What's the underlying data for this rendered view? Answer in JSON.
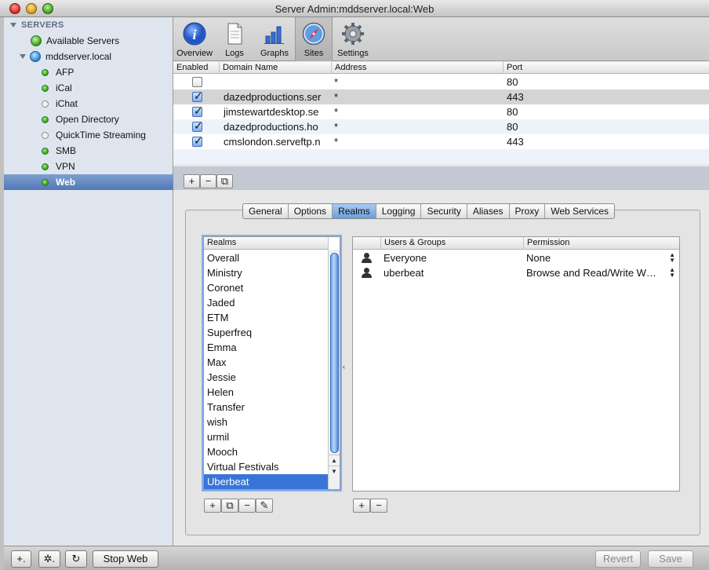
{
  "window": {
    "title": "Server Admin:mddserver.local:Web"
  },
  "sidebar": {
    "header": "SERVERS",
    "items": [
      {
        "label": "Available Servers",
        "icon": "available-servers-icon",
        "status": "globe-green"
      },
      {
        "label": "mddserver.local",
        "icon": "server-globe-icon",
        "status": "globe"
      },
      {
        "label": "AFP",
        "status": "running"
      },
      {
        "label": "iCal",
        "status": "running"
      },
      {
        "label": "iChat",
        "status": "stopped"
      },
      {
        "label": "Open Directory",
        "status": "running"
      },
      {
        "label": "QuickTime Streaming",
        "status": "stopped"
      },
      {
        "label": "SMB",
        "status": "running"
      },
      {
        "label": "VPN",
        "status": "running"
      },
      {
        "label": "Web",
        "status": "running",
        "selected": true
      }
    ]
  },
  "toolbar": {
    "buttons": [
      {
        "label": "Overview",
        "icon": "info-icon"
      },
      {
        "label": "Logs",
        "icon": "document-icon"
      },
      {
        "label": "Graphs",
        "icon": "bar-graph-icon"
      },
      {
        "label": "Sites",
        "icon": "compass-icon",
        "active": true
      },
      {
        "label": "Settings",
        "icon": "gear-icon"
      }
    ]
  },
  "sites_table": {
    "columns": [
      "Enabled",
      "Domain Name",
      "Address",
      "Port"
    ],
    "rows": [
      {
        "enabled": false,
        "domain": "",
        "address": "*",
        "port": "80"
      },
      {
        "enabled": true,
        "domain": "dazedproductions.ser",
        "address": "*",
        "port": "443"
      },
      {
        "enabled": true,
        "domain": "jimstewartdesktop.se",
        "address": "*",
        "port": "80"
      },
      {
        "enabled": true,
        "domain": "dazedproductions.ho",
        "address": "*",
        "port": "80"
      },
      {
        "enabled": true,
        "domain": "cmslondon.serveftp.n",
        "address": "*",
        "port": "443"
      }
    ],
    "buttons": {
      "add": "+",
      "remove": "−",
      "duplicate": "⧉"
    }
  },
  "tabs": {
    "items": [
      "General",
      "Options",
      "Realms",
      "Logging",
      "Security",
      "Aliases",
      "Proxy",
      "Web Services"
    ],
    "active": "Realms"
  },
  "realms": {
    "header": "Realms",
    "items": [
      "Overall",
      "Ministry",
      "Coronet",
      "Jaded",
      "ETM",
      "Superfreq",
      "Emma",
      "Max",
      "Jessie",
      "Helen",
      "Transfer",
      "wish",
      "urmil",
      "Mooch",
      "Virtual Festivals",
      "Uberbeat"
    ],
    "selected": "Uberbeat",
    "buttons": {
      "add": "+",
      "duplicate": "⧉",
      "remove": "−",
      "edit": "✎"
    }
  },
  "users_groups": {
    "columns": [
      "Users & Groups",
      "Permission"
    ],
    "rows": [
      {
        "name": "Everyone",
        "permission": "None"
      },
      {
        "name": "uberbeat",
        "permission": "Browse and Read/Write W…"
      }
    ],
    "buttons": {
      "add": "+",
      "remove": "−"
    }
  },
  "bottombar": {
    "add": "+.",
    "action": "✲.",
    "refresh": "↻",
    "stop": "Stop Web",
    "revert": "Revert",
    "save": "Save"
  }
}
